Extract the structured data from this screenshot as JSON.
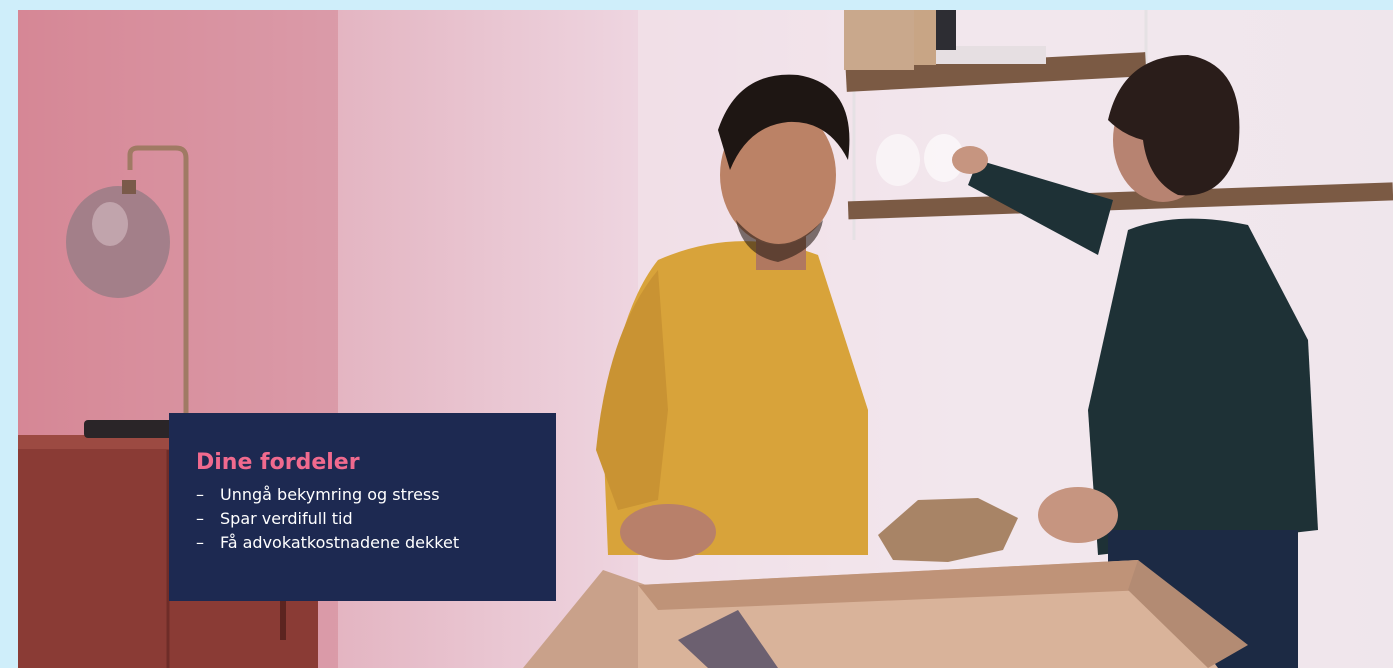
{
  "benefits": {
    "title": "Dine fordeler",
    "items": [
      {
        "bullet": "–",
        "text": "Unngå bekymring og stress"
      },
      {
        "bullet": "–",
        "text": "Spar verdifull tid"
      },
      {
        "bullet": "–",
        "text": "Få advokatkostnadene dekket"
      }
    ]
  },
  "colors": {
    "card_background": "#1d2951",
    "title": "#f06a8e",
    "item_text": "#ffffff",
    "top_strip": "#cfeefa"
  }
}
